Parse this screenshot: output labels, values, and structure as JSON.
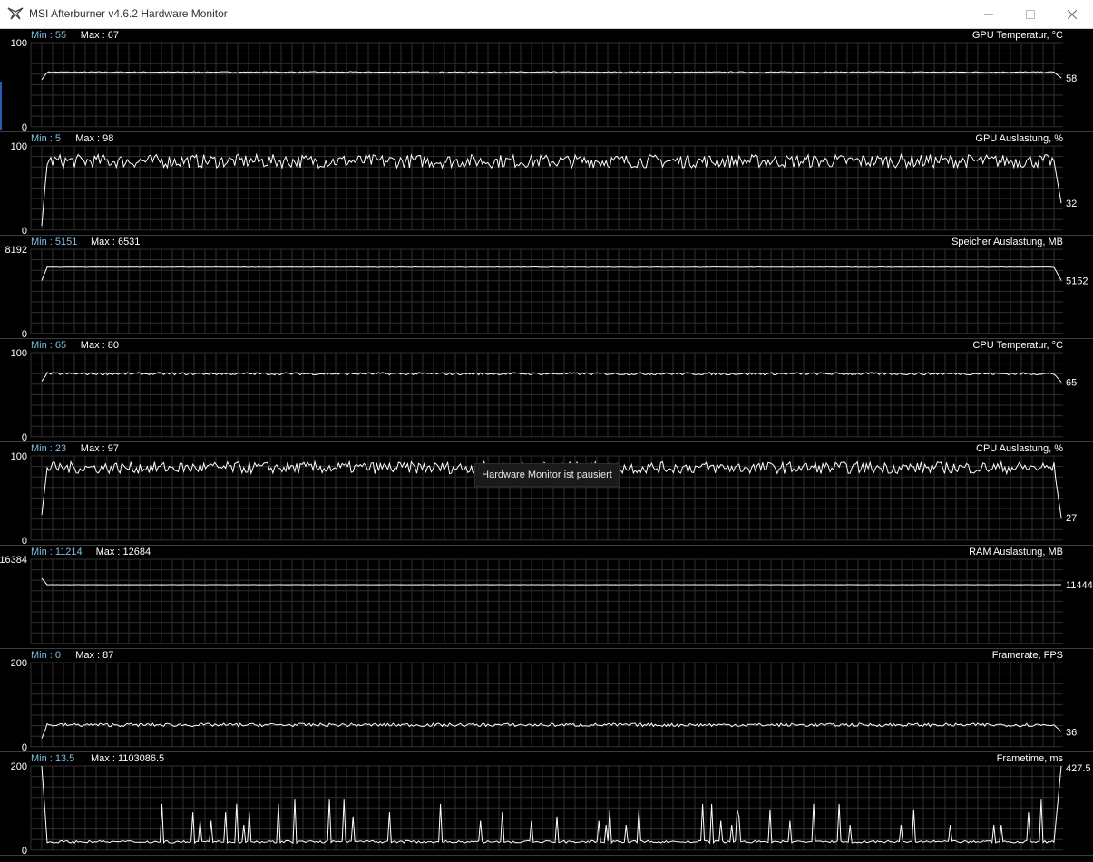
{
  "window": {
    "title": "MSI Afterburner v4.6.2 Hardware Monitor",
    "icon": "msi-afterburner-logo-icon",
    "controls": {
      "minimize": "minimize-icon",
      "maximize": "maximize-icon",
      "close": "close-icon"
    }
  },
  "colors": {
    "background": "#000000",
    "grid": "#2f2f2f",
    "separator": "#3c3c3c",
    "trace": "#ffffff",
    "min_label": "#7cc0e0",
    "max_label": "#ffffff",
    "text": "#ffffff"
  },
  "tooltip": "Hardware Monitor ist pausiert",
  "graphs": [
    {
      "name": "GPU Temperatur, °C",
      "min": "Min : 55",
      "max": "Max : 67",
      "y_top": "100",
      "y_bottom": "0",
      "current": "58"
    },
    {
      "name": "GPU Auslastung, %",
      "min": "Min : 5",
      "max": "Max : 98",
      "y_top": "100",
      "y_bottom": "0",
      "current": "32"
    },
    {
      "name": "Speicher Auslastung, MB",
      "min": "Min : 5151",
      "max": "Max : 6531",
      "y_top": "8192",
      "y_bottom": "0",
      "current": "5152"
    },
    {
      "name": "CPU Temperatur, °C",
      "min": "Min : 65",
      "max": "Max : 80",
      "y_top": "100",
      "y_bottom": "0",
      "current": "65"
    },
    {
      "name": "CPU Auslastung, %",
      "min": "Min : 23",
      "max": "Max : 97",
      "y_top": "100",
      "y_bottom": "0",
      "current": "27"
    },
    {
      "name": "RAM Auslastung, MB",
      "min": "Min : 11214",
      "max": "Max : 12684",
      "y_top": "16384",
      "y_bottom": "",
      "current": "11444"
    },
    {
      "name": "Framerate, FPS",
      "min": "Min : 0",
      "max": "Max : 87",
      "y_top": "200",
      "y_bottom": "0",
      "current": "36"
    },
    {
      "name": "Frametime, ms",
      "min": "Min : 13.5",
      "max": "Max : 1103086.5",
      "y_top": "200",
      "y_bottom": "0",
      "current": "427.5"
    }
  ],
  "chart_data": [
    {
      "type": "line",
      "title": "GPU Temperatur, °C",
      "ylim": [
        0,
        100
      ],
      "current": 58,
      "series": [
        {
          "start": 56,
          "level": 65,
          "noise": 0.6,
          "end": 58,
          "spikes": []
        }
      ]
    },
    {
      "type": "line",
      "title": "GPU Auslastung, %",
      "ylim": [
        0,
        100
      ],
      "current": 32,
      "series": [
        {
          "start": 5,
          "level": 82,
          "noise": 8,
          "end": 32,
          "spikes": []
        }
      ]
    },
    {
      "type": "line",
      "title": "Speicher Auslastung, MB",
      "ylim": [
        0,
        8192
      ],
      "current": 5152,
      "series": [
        {
          "start": 5151,
          "level": 6450,
          "noise": 20,
          "end": 5152,
          "spikes": []
        }
      ]
    },
    {
      "type": "line",
      "title": "CPU Temperatur, °C",
      "ylim": [
        0,
        100
      ],
      "current": 65,
      "series": [
        {
          "start": 66,
          "level": 75,
          "noise": 1.5,
          "end": 65,
          "spikes": []
        }
      ]
    },
    {
      "type": "line",
      "title": "CPU Auslastung, %",
      "ylim": [
        0,
        100
      ],
      "current": 27,
      "series": [
        {
          "start": 30,
          "level": 86,
          "noise": 7,
          "end": 27,
          "spikes": []
        }
      ]
    },
    {
      "type": "line",
      "title": "RAM Auslastung, MB",
      "ylim": [
        0,
        16384
      ],
      "current": 11444,
      "series": [
        {
          "start": 12684,
          "level": 11444,
          "noise": 10,
          "end": 11444,
          "spikes": []
        }
      ]
    },
    {
      "type": "line",
      "title": "Framerate, FPS",
      "ylim": [
        0,
        200
      ],
      "current": 36,
      "series": [
        {
          "start": 20,
          "level": 52,
          "noise": 4,
          "end": 36,
          "spikes": []
        }
      ]
    },
    {
      "type": "line",
      "title": "Frametime, ms",
      "ylim": [
        0,
        200
      ],
      "current": 427.5,
      "series": [
        {
          "start": 200,
          "level": 20,
          "noise": 3,
          "end": 200,
          "spikes": [
            60,
            80,
            95,
            110,
            120,
            90,
            70
          ]
        }
      ]
    }
  ]
}
